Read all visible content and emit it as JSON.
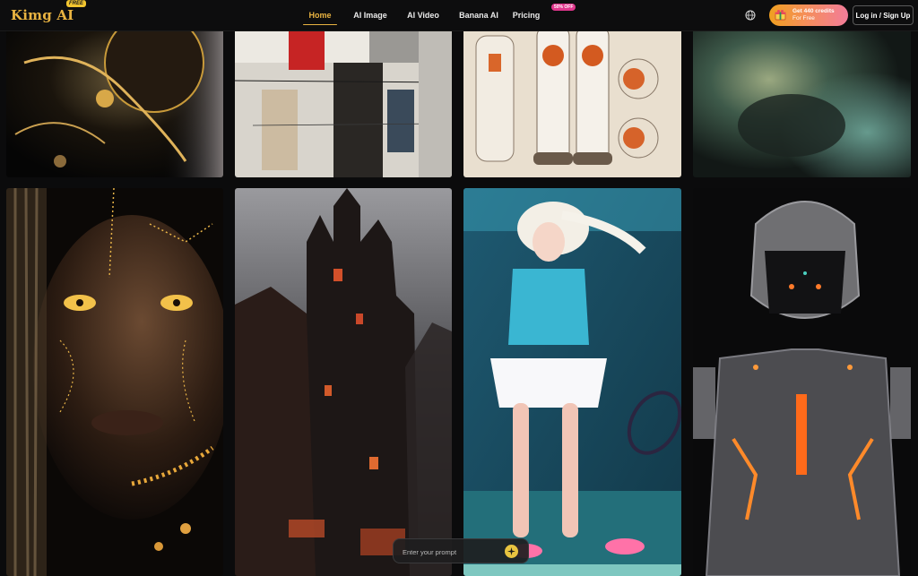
{
  "header": {
    "logo_text": "Kimg AI",
    "logo_badge": "FREE",
    "nav": [
      {
        "label": "Home",
        "active": true
      },
      {
        "label": "AI Image",
        "active": false
      },
      {
        "label": "AI Video",
        "active": false
      },
      {
        "label": "Banana AI",
        "active": false
      },
      {
        "label": "Pricing",
        "active": false
      }
    ],
    "pricing_badge": "50% OFF",
    "credits_line1": "Get 440 credits",
    "credits_line2": "For Free",
    "login_label": "Log in / Sign Up",
    "accent_color": "#e9b341"
  },
  "gallery": {
    "tiles": [
      {
        "subject": "dark golden robot helmet"
      },
      {
        "subject": "abstract painted industrial composition"
      },
      {
        "subject": "robot suit concept sketch sheet"
      },
      {
        "subject": "blurry green abstract"
      },
      {
        "subject": "woman with golden circuit face paint"
      },
      {
        "subject": "gothic dark castle tower"
      },
      {
        "subject": "anime girl tennis player"
      },
      {
        "subject": "glowing orange armored robot"
      }
    ]
  },
  "prompt": {
    "placeholder": "Enter your prompt"
  }
}
